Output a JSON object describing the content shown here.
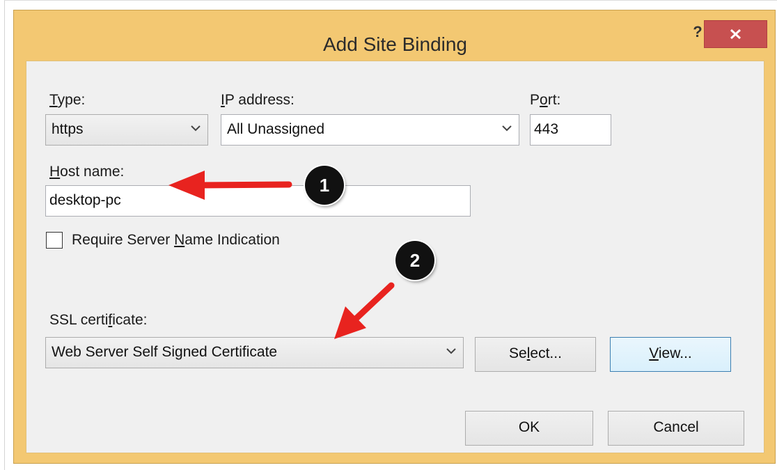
{
  "dialog": {
    "title": "Add Site Binding",
    "help_glyph": "?",
    "close_icon": "close-icon"
  },
  "type": {
    "label": "Type:",
    "value": "https"
  },
  "ip": {
    "label": "IP address:",
    "value": "All Unassigned"
  },
  "port": {
    "label": "Port:",
    "value": "443"
  },
  "host": {
    "label": "Host name:",
    "value": "desktop-pc"
  },
  "sni": {
    "label": "Require Server Name Indication",
    "checked": false
  },
  "ssl": {
    "label": "SSL certificate:",
    "value": "Web Server Self Signed Certificate",
    "select_label": "Select...",
    "view_label": "View..."
  },
  "actions": {
    "ok_label": "OK",
    "cancel_label": "Cancel"
  },
  "annotations": {
    "badge1": "1",
    "badge2": "2",
    "arrow_color": "#e8231f"
  },
  "colors": {
    "frame": "#f3c872",
    "close": "#c75050",
    "client": "#f0f0f0"
  }
}
